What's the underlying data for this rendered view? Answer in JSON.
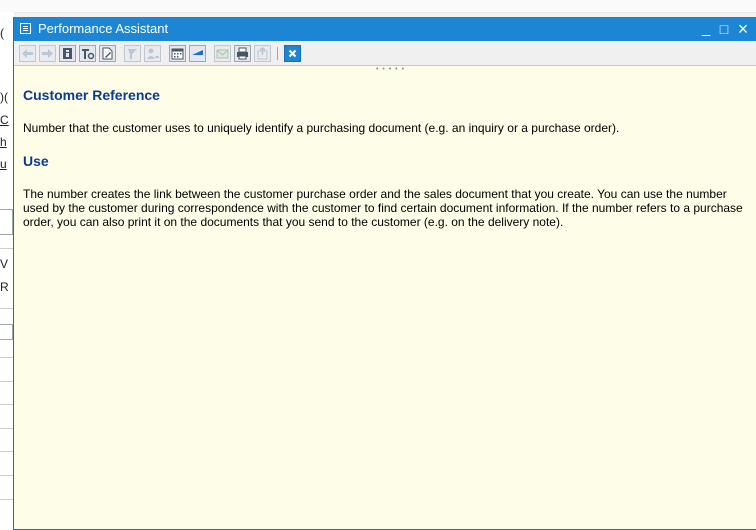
{
  "window": {
    "title": "Performance Assistant",
    "minimize_glyph": "_",
    "maximize_glyph": "□",
    "close_glyph": "×"
  },
  "toolbar": {
    "buttons": [
      {
        "name": "back-icon",
        "enabled": false
      },
      {
        "name": "forward-icon",
        "enabled": false
      },
      {
        "name": "technical-info-icon",
        "enabled": true
      },
      {
        "name": "settings-icon",
        "enabled": true
      },
      {
        "name": "edit-document-icon",
        "enabled": true
      },
      {
        "name": "help-pointer-icon",
        "enabled": false
      },
      {
        "name": "user-icon",
        "enabled": false
      },
      {
        "name": "calendar-icon",
        "enabled": true
      },
      {
        "name": "blue-flag-icon",
        "enabled": true
      },
      {
        "name": "email-icon",
        "enabled": false
      },
      {
        "name": "print-icon",
        "enabled": true
      },
      {
        "name": "export-icon",
        "enabled": false
      },
      {
        "name": "close-help-icon",
        "enabled": true
      }
    ]
  },
  "content": {
    "heading1": "Customer Reference",
    "paragraph1": "Number that the customer uses to uniquely identify a purchasing document (e.g. an inquiry or a purchase order).",
    "heading2": "Use",
    "paragraph2": "The number creates the link between the customer purchase order and the sales document that you create. You can use the number used by the customer during correspondence with the customer to find certain document information. If the number refers to a purchase order, you can also print it on the documents that you send to the customer (e.g. on the delivery note)."
  },
  "colors": {
    "titlebar": "#1c86d4",
    "content_bg": "#fefee8",
    "heading": "#0c3b8b"
  }
}
